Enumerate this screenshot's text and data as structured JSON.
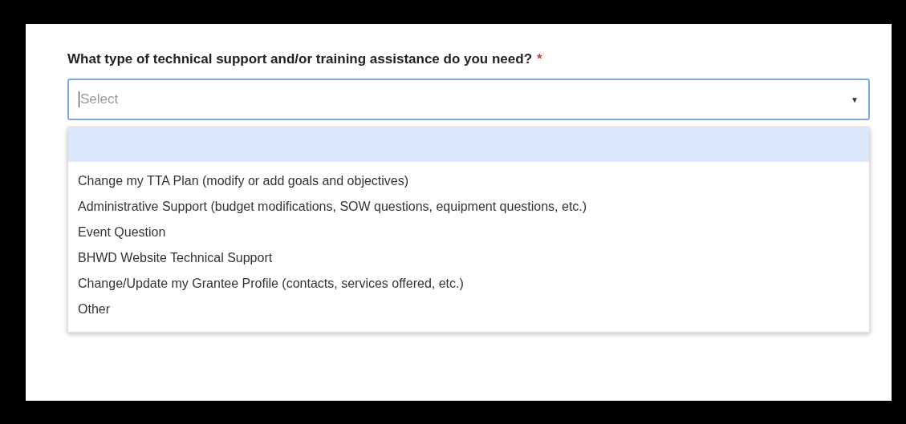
{
  "question": {
    "label": "What type of technical support and/or training assistance do you need?",
    "required": true,
    "required_mark": "*"
  },
  "select": {
    "placeholder": "Select",
    "expanded": true,
    "caret": "▼"
  },
  "dropdown": {
    "blank_option": {
      "highlighted": true
    },
    "options": [
      {
        "label": "Change my TTA Plan (modify or add goals and objectives)",
        "highlighted": false
      },
      {
        "label": "Administrative Support (budget modifications, SOW questions, equipment questions, etc.)",
        "highlighted": false
      },
      {
        "label": "Event Question",
        "highlighted": false
      },
      {
        "label": "BHWD Website Technical Support",
        "highlighted": false
      },
      {
        "label": "Change/Update my Grantee Profile (contacts, services offered, etc.)",
        "highlighted": false
      },
      {
        "label": "Other",
        "highlighted": false
      }
    ]
  }
}
